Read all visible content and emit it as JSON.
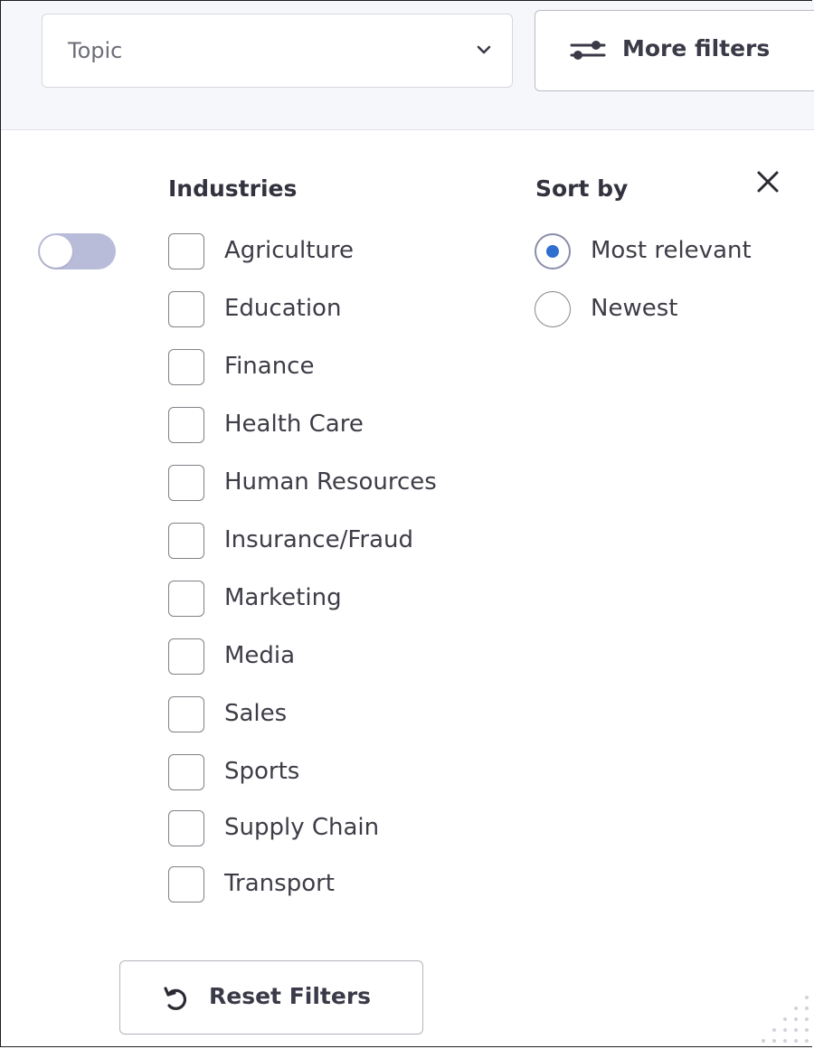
{
  "topic_select": {
    "value": "Topic",
    "icon": "chevron-down-icon"
  },
  "more_filters": {
    "label": "More filters",
    "icon": "sliders-icon"
  },
  "toggle": {
    "on": false
  },
  "industries": {
    "title": "Industries",
    "items": [
      {
        "label": "Agriculture",
        "checked": false
      },
      {
        "label": "Education",
        "checked": false
      },
      {
        "label": "Finance",
        "checked": false
      },
      {
        "label": "Health Care",
        "checked": false
      },
      {
        "label": "Human Resources",
        "checked": false
      },
      {
        "label": "Insurance/Fraud",
        "checked": false
      },
      {
        "label": "Marketing",
        "checked": false
      },
      {
        "label": "Media",
        "checked": false
      },
      {
        "label": "Sales",
        "checked": false
      },
      {
        "label": "Sports",
        "checked": false
      },
      {
        "label": "Supply Chain",
        "checked": false
      },
      {
        "label": "Transport",
        "checked": false
      }
    ]
  },
  "sort": {
    "title": "Sort by",
    "options": [
      {
        "label": "Most relevant",
        "selected": true
      },
      {
        "label": "Newest",
        "selected": false
      }
    ],
    "close_icon": "close-icon"
  },
  "reset": {
    "label": "Reset Filters",
    "icon": "reset-icon"
  },
  "colors": {
    "accent": "#2f6fd0",
    "toggle_track": "#b9bcd9",
    "topbar_bg": "#f6f7fb"
  }
}
